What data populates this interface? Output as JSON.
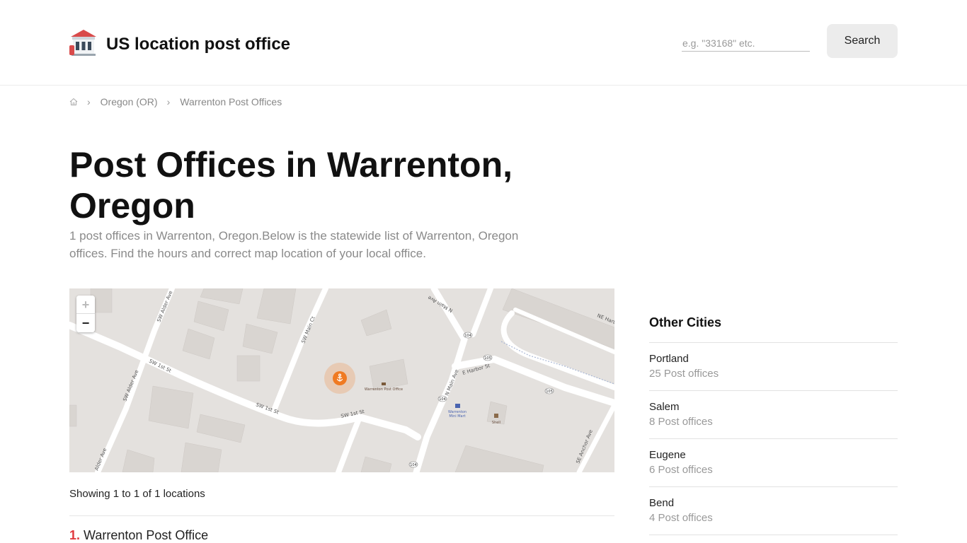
{
  "header": {
    "site_title": "US location post office",
    "search_placeholder": "e.g. \"33168\" etc.",
    "search_label": "Search"
  },
  "breadcrumb": {
    "home_icon": "home-icon",
    "items": [
      "Oregon (OR)",
      "Warrenton Post Offices"
    ]
  },
  "page": {
    "title": "Post Offices in Warrenton, Oregon",
    "intro": "1 post offices in Warrenton, Oregon.Below is the statewide list of Warrenton, Oregon offices. Find the hours and correct map location of your local office."
  },
  "map": {
    "zoom_in": "+",
    "zoom_out": "−",
    "marker_icon": "anchor-icon",
    "labels": {
      "sw_alder_ave": "SW Alder Ave",
      "sw_main_ct": "SW Main Ct",
      "n_main_ave": "N Main Ave",
      "ne_harbor": "NE Harbor",
      "sw_1st_st": "SW 1st St",
      "e_harbor_st": "E Harbor St",
      "se_anchor_ave": "SE Anchor Ave",
      "alder_ave": "Alder Ave",
      "route_104": "104",
      "route_105": "105",
      "post_office": "Warrenton Post Office",
      "mini_mart_1": "Warrenton",
      "mini_mart_2": "Mini Mart",
      "shell": "Shell"
    },
    "colors": {
      "land": "#e4e1de",
      "road": "#ffffff",
      "building": "#d9d5d1",
      "marker": "#f07a22"
    }
  },
  "results": {
    "showing": "Showing 1 to 1 of 1 locations",
    "items": [
      {
        "number": "1.",
        "name": "Warrenton Post Office"
      }
    ]
  },
  "sidebar": {
    "title": "Other Cities",
    "cities": [
      {
        "name": "Portland",
        "count": "25 Post offices"
      },
      {
        "name": "Salem",
        "count": "8 Post offices"
      },
      {
        "name": "Eugene",
        "count": "6 Post offices"
      },
      {
        "name": "Bend",
        "count": "4 Post offices"
      }
    ]
  }
}
